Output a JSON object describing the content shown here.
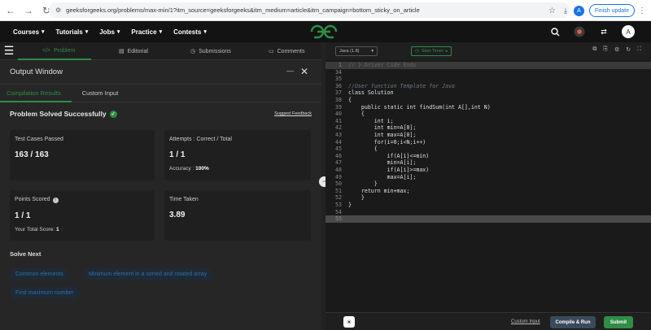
{
  "browser": {
    "url": "geeksforgeeks.org/problems/max-min/1?itm_source=geeksforgeeks&itm_medium=article&itm_campaign=bottom_sticky_on_article",
    "profile_initial": "A",
    "finish_update_label": "Finish update"
  },
  "sitenav": {
    "menu": [
      {
        "label": "Courses"
      },
      {
        "label": "Tutorials"
      },
      {
        "label": "Jobs"
      },
      {
        "label": "Practice"
      },
      {
        "label": "Contests"
      }
    ],
    "logo_text": "GG",
    "user_initial": "A"
  },
  "problem_tabs": [
    {
      "label": "Problem",
      "icon": "code-icon"
    },
    {
      "label": "Editorial",
      "icon": "editorial-icon"
    },
    {
      "label": "Submissions",
      "icon": "submissions-icon"
    },
    {
      "label": "Comments",
      "icon": "comments-icon"
    }
  ],
  "output": {
    "title": "Output Window",
    "subtabs": [
      "Compilation Results",
      "Custom Input"
    ],
    "status": "Problem Solved Successfully",
    "feedback_link": "Suggest Feedback",
    "cards": {
      "test_cases": {
        "label": "Test Cases Passed",
        "value": "163 / 163"
      },
      "attempts": {
        "label": "Attempts : Correct / Total",
        "value": "1 / 1",
        "accuracy_label": "Accuracy :",
        "accuracy_value": "100%"
      },
      "points": {
        "label": "Points Scored",
        "value": "1 / 1",
        "total_label": "Your Total Score:",
        "total_value": "1"
      },
      "time": {
        "label": "Time Taken",
        "value": "3.89"
      }
    },
    "solve_next_title": "Solve Next",
    "solve_next": [
      "Common elements",
      "Minimum element in a sorted and rotated array",
      "Find maximum number"
    ]
  },
  "editor": {
    "language": "Java (1.8)",
    "timer_label": "Start Timer",
    "lines": [
      {
        "n": "1",
        "text": "// } Driver Code Ends",
        "kind": "current"
      },
      {
        "n": "34",
        "text": "",
        "kind": ""
      },
      {
        "n": "35",
        "text": "",
        "kind": ""
      },
      {
        "n": "36",
        "text": "//User function Template for Java",
        "kind": "comment"
      },
      {
        "n": "37",
        "text": "class Solution",
        "kind": ""
      },
      {
        "n": "38",
        "text": "{",
        "kind": ""
      },
      {
        "n": "39",
        "text": "    public static int findSum(int A[],int N)",
        "kind": ""
      },
      {
        "n": "40",
        "text": "    {",
        "kind": ""
      },
      {
        "n": "41",
        "text": "        int i;",
        "kind": ""
      },
      {
        "n": "42",
        "text": "        int min=A[0];",
        "kind": ""
      },
      {
        "n": "43",
        "text": "        int max=A[0];",
        "kind": ""
      },
      {
        "n": "44",
        "text": "        for(i=0;i<N;i++)",
        "kind": ""
      },
      {
        "n": "45",
        "text": "        {",
        "kind": ""
      },
      {
        "n": "46",
        "text": "            if(A[i]<=min)",
        "kind": ""
      },
      {
        "n": "47",
        "text": "            min=A[i];",
        "kind": ""
      },
      {
        "n": "48",
        "text": "            if(A[i]>=max)",
        "kind": ""
      },
      {
        "n": "49",
        "text": "            max=A[i];",
        "kind": ""
      },
      {
        "n": "50",
        "text": "        }",
        "kind": ""
      },
      {
        "n": "51",
        "text": "    return min+max;",
        "kind": ""
      },
      {
        "n": "52",
        "text": "    }",
        "kind": ""
      },
      {
        "n": "53",
        "text": "}",
        "kind": ""
      },
      {
        "n": "54",
        "text": "",
        "kind": ""
      },
      {
        "n": "55",
        "text": "",
        "kind": "hl"
      }
    ],
    "custom_input_label": "Custom Input",
    "compile_label": "Compile & Run",
    "submit_label": "Submit"
  },
  "colors": {
    "accent": "#2f8d46",
    "link": "#2d6ea8"
  }
}
